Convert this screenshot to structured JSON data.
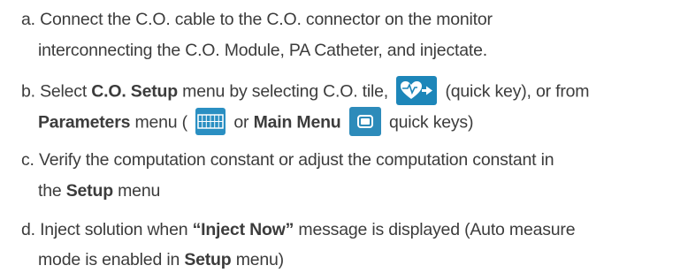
{
  "steps": {
    "a": {
      "line1": "a. Connect the C.O. cable to the C.O. connector on the monitor",
      "line2": "interconnecting the C.O. Module, PA Catheter, and injectate."
    },
    "b": {
      "prefix": "b. Select ",
      "menu_co_setup": "C.O. Setup",
      "mid": " menu by selecting C.O. tile,",
      "quick_key_note": " (quick key), or from",
      "menu_parameters": "Parameters",
      "menu_text": " menu (",
      "or_text": " or ",
      "menu_main": "Main Menu",
      "quick_keys_note": " quick keys)",
      "icons": [
        "heart-arrow-icon",
        "parameters-grid-icon",
        "main-menu-icon"
      ]
    },
    "c": {
      "line1": "c. Verify the computation constant or adjust the computation constant in",
      "line2_prefix": "the ",
      "line2_bold": "Setup",
      "line2_suffix": " menu"
    },
    "d": {
      "prefix": "d. Inject solution when ",
      "bold": "“Inject Now”",
      "suffix": " message is displayed (Auto measure",
      "line2_prefix": "mode is enabled in ",
      "line2_bold": "Setup",
      "line2_suffix": " menu)"
    }
  },
  "colors": {
    "text": "#3c3c3c",
    "accent": "#1d86b9"
  }
}
